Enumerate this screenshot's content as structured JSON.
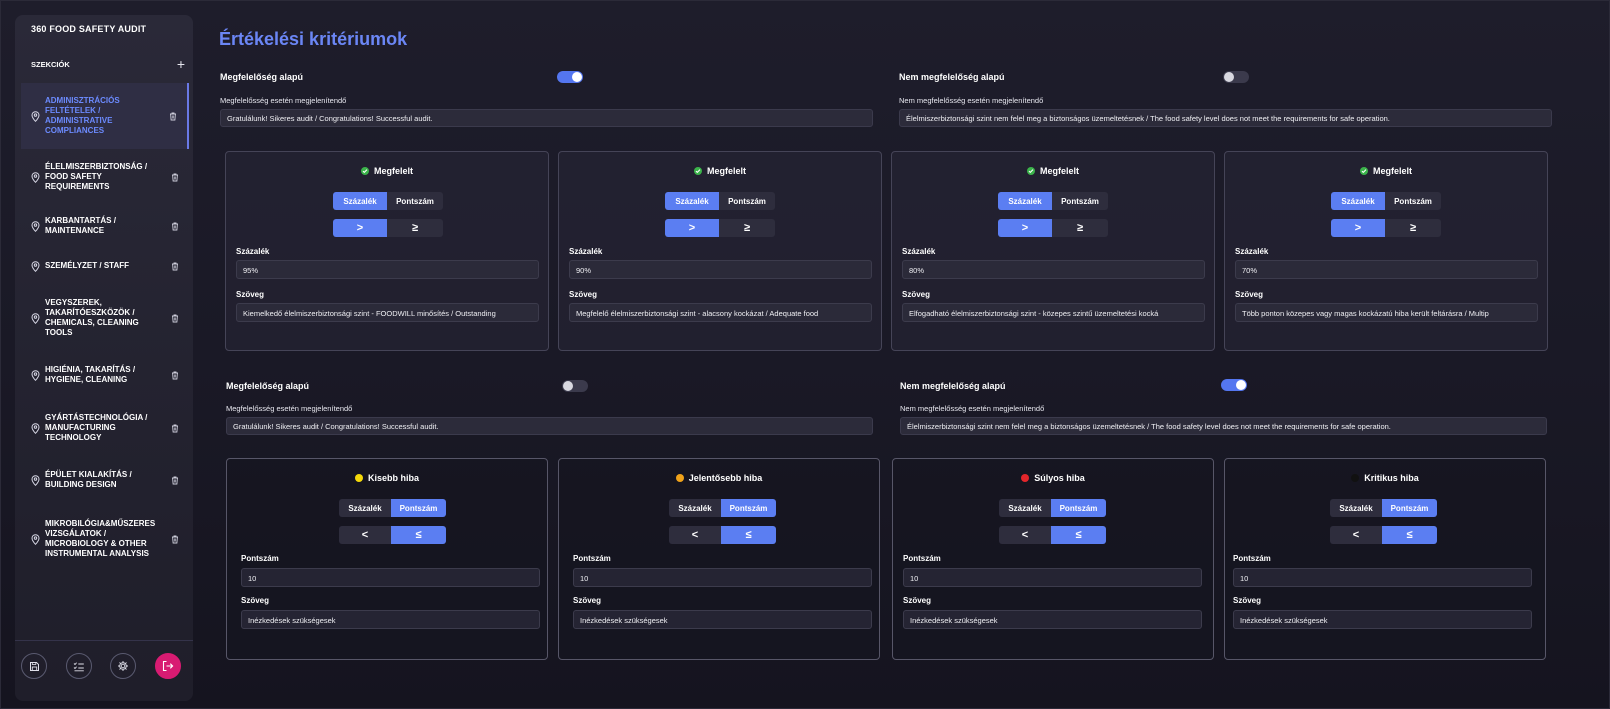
{
  "sidebar": {
    "title": "360 FOOD SAFETY AUDIT",
    "sections_label": "SZEKCIÓK",
    "items": [
      {
        "label": "ADMINISZTRÁCIÓS\nFELTÉTELEK /\nADMINISTRATIVE\nCOMPLIANCES",
        "active": true
      },
      {
        "label": "ÉLELMISZERBIZTONSÁG /\nFOOD SAFETY\nREQUIREMENTS",
        "active": false
      },
      {
        "label": "KARBANTARTÁS /\nMAINTENANCE",
        "active": false
      },
      {
        "label": "SZEMÉLYZET / STAFF",
        "active": false
      },
      {
        "label": "VEGYSZEREK,\nTAKARÍTÓESZKÖZÖK /\nCHEMICALS, CLEANING\nTOOLS",
        "active": false
      },
      {
        "label": "HIGIÉNIA, TAKARÍTÁS /\nHYGIENE, CLEANING",
        "active": false
      },
      {
        "label": "GYÁRTÁSTECHNOLÓGIA /\nMANUFACTURING\nTECHNOLOGY",
        "active": false
      },
      {
        "label": "ÉPÜLET KIALAKÍTÁS /\nBUILDING DESIGN",
        "active": false
      },
      {
        "label": "MIKROBILÓGIA&MŰSZERES\nVIZSGÁLATOK /\nMICROBIOLOGY & OTHER\nINSTRUMENTAL ANALYSIS",
        "active": false
      }
    ]
  },
  "main": {
    "title": "Értékelési kritériumok",
    "block1": {
      "left_toggle_label": "Megfelelőség alapú",
      "left_toggle_on": true,
      "right_toggle_label": "Nem megfelelőség alapú",
      "right_toggle_on": false,
      "left_field_label": "Megfelelősség esetén megjelenítendő",
      "left_field_value": "Gratulálunk! Sikeres audit / Congratulations! Successful audit.",
      "right_field_label": "Nem megfelelősség esetén megjelenítendő",
      "right_field_value": "Élelmiszerbiztonsági szint nem felel meg a biztonságos üzemeltetésnek / The food safety level does not meet the requirements for safe operation.",
      "cards": [
        {
          "title": "Megfelelt",
          "tab_a": "Százalék",
          "tab_b": "Pontszám",
          "op_a": ">",
          "op_b": "≥",
          "value_label": "Százalék",
          "value": "95%",
          "text_label": "Szöveg",
          "text": "Kiemelkedő élelmiszerbiztonsági szint - FOODWILL minősítés / Outstanding"
        },
        {
          "title": "Megfelelt",
          "tab_a": "Százalék",
          "tab_b": "Pontszám",
          "op_a": ">",
          "op_b": "≥",
          "value_label": "Százalék",
          "value": "90%",
          "text_label": "Szöveg",
          "text": "Megfelelő élelmiszerbiztonsági szint - alacsony kockázat / Adequate food"
        },
        {
          "title": "Megfelelt",
          "tab_a": "Százalék",
          "tab_b": "Pontszám",
          "op_a": ">",
          "op_b": "≥",
          "value_label": "Százalék",
          "value": "80%",
          "text_label": "Szöveg",
          "text": "Elfogadható élelmiszerbiztonsági szint - közepes szintű üzemeltetési kocká"
        },
        {
          "title": "Megfelelt",
          "tab_a": "Százalék",
          "tab_b": "Pontszám",
          "op_a": ">",
          "op_b": "≥",
          "value_label": "Százalék",
          "value": "70%",
          "text_label": "Szöveg",
          "text": "Több ponton közepes vagy magas kockázatú hiba került feltárásra / Multip"
        }
      ]
    },
    "block2": {
      "left_toggle_label": "Megfelelőség alapú",
      "left_toggle_on": false,
      "right_toggle_label": "Nem megfelelőség alapú",
      "right_toggle_on": true,
      "left_field_label": "Megfelelősség esetén megjelenítendő",
      "left_field_value": "Gratulálunk! Sikeres audit / Congratulations! Successful audit.",
      "right_field_label": "Nem megfelelősség esetén megjelenítendő",
      "right_field_value": "Élelmiszerbiztonsági szint nem felel meg a biztonságos üzemeltetésnek / The food safety level does not meet the requirements for safe operation.",
      "cards": [
        {
          "title": "Kisebb hiba",
          "dot_color": "#f5d90a",
          "tab_a": "Százalék",
          "tab_b": "Pontszám",
          "op_a": "<",
          "op_b": "≤",
          "value_label": "Pontszám",
          "value": "10",
          "text_label": "Szöveg",
          "text": "Inézkedések szükségesek"
        },
        {
          "title": "Jelentősebb hiba",
          "dot_color": "#f0a21a",
          "tab_a": "Százalék",
          "tab_b": "Pontszám",
          "op_a": "<",
          "op_b": "≤",
          "value_label": "Pontszám",
          "value": "10",
          "text_label": "Szöveg",
          "text": "Inézkedések szükségesek"
        },
        {
          "title": "Súlyos hiba",
          "dot_color": "#e3262b",
          "tab_a": "Százalék",
          "tab_b": "Pontszám",
          "op_a": "<",
          "op_b": "≤",
          "value_label": "Pontszám",
          "value": "10",
          "text_label": "Szöveg",
          "text": "Inézkedések szükségesek"
        },
        {
          "title": "Kritikus hiba",
          "dot_color": "#111111",
          "tab_a": "Százalék",
          "tab_b": "Pontszám",
          "op_a": "<",
          "op_b": "≤",
          "value_label": "Pontszám",
          "value": "10",
          "text_label": "Szöveg",
          "text": "Inézkedések szükségesek"
        }
      ]
    }
  },
  "colors": {
    "accent": "#5b7ef2",
    "title": "#6b86f5",
    "success": "#3bb34a",
    "logout": "#d81b72"
  }
}
